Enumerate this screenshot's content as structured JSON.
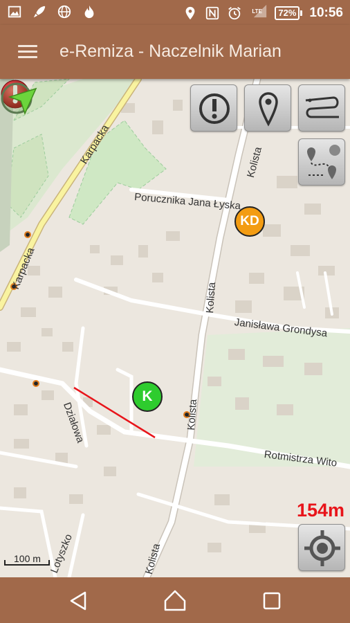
{
  "status_bar": {
    "time": "10:56",
    "battery": "72%",
    "network": "LTE",
    "icons": [
      "image-icon",
      "rocket-icon",
      "globe-icon",
      "fire-icon",
      "location-icon",
      "nfc-icon",
      "alarm-icon",
      "signal-icon"
    ]
  },
  "app_bar": {
    "title": "e-Remiza - Naczelnik Marian",
    "menu_icon": "hamburger-menu-icon"
  },
  "map": {
    "streets": [
      "Karpacka",
      "Karpacka",
      "Kolista",
      "Kolista",
      "Kolista",
      "Kolista",
      "Porucznika Jana Łyska",
      "Janisława Grondysa",
      "Działowa",
      "Rotmistrza Wito",
      "Lotyszko"
    ],
    "markers": {
      "kd_label": "KD",
      "k_label": "K",
      "kd_color": "#f39c12",
      "k_color": "#2ecc2e"
    },
    "distance": "154m",
    "scale_label": "100 m",
    "buttons": [
      "alert-button",
      "location-pin-button",
      "route-button",
      "route-points-button",
      "my-location-button"
    ]
  },
  "nav_bar": {
    "buttons": [
      "back-icon",
      "home-icon",
      "recents-icon"
    ]
  }
}
